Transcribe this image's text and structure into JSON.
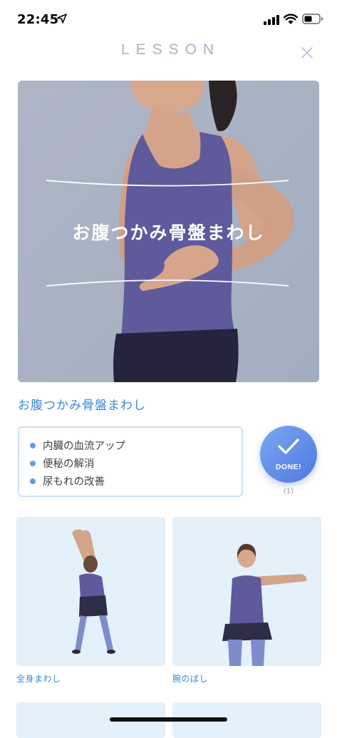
{
  "status_bar": {
    "time": "22:45",
    "icons": [
      "location-arrow-icon",
      "signal-icon",
      "wifi-icon",
      "battery-icon"
    ]
  },
  "header": {
    "title": "LESSON",
    "close_icon": "close-icon"
  },
  "hero": {
    "title": "お腹つかみ骨盤まわし"
  },
  "lesson": {
    "name": "お腹つかみ骨盤まわし",
    "benefits": [
      "内臓の血流アップ",
      "便秘の解消",
      "尿もれの改善"
    ]
  },
  "done_button": {
    "label": "DONE!",
    "count": "(1)",
    "icon": "checkmark-icon"
  },
  "related_lessons": [
    {
      "label": "全身まわし"
    },
    {
      "label": "腕のばし"
    }
  ],
  "colors": {
    "accent_blue": "#3d86d6",
    "header_gray": "#a9b1c7",
    "done_gradient_start": "#7ba8f2",
    "done_gradient_end": "#4f78e0",
    "card_bg": "#e4f1fb",
    "outfit_purple": "#5e5a9c"
  }
}
